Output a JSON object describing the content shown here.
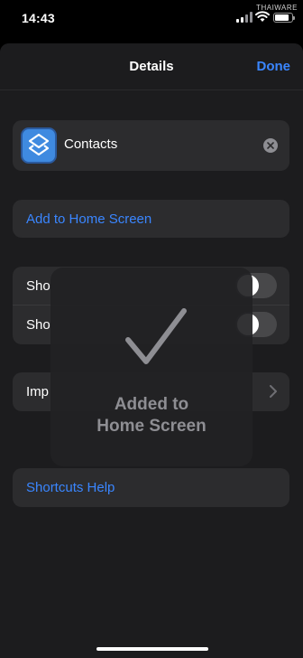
{
  "status_bar": {
    "time": "14:43",
    "watermark": "THAIWARE",
    "battery_level": 0.85
  },
  "nav": {
    "title": "Details",
    "done_label": "Done"
  },
  "shortcut": {
    "name": "Contacts",
    "icon": "shortcuts-stack-icon",
    "icon_color": "#3f8ae0"
  },
  "actions": {
    "add_home_label": "Add to Home Screen",
    "help_label": "Shortcuts Help"
  },
  "toggles": [
    {
      "label": "Sho",
      "on": false
    },
    {
      "label": "Sho",
      "on": false
    }
  ],
  "import": {
    "label": "Imp"
  },
  "hud": {
    "line1": "Added to",
    "line2": "Home Screen",
    "icon": "checkmark-icon"
  },
  "colors": {
    "accent": "#3a86ff",
    "sheet": "#1c1c1e",
    "card": "#2c2c2e"
  }
}
